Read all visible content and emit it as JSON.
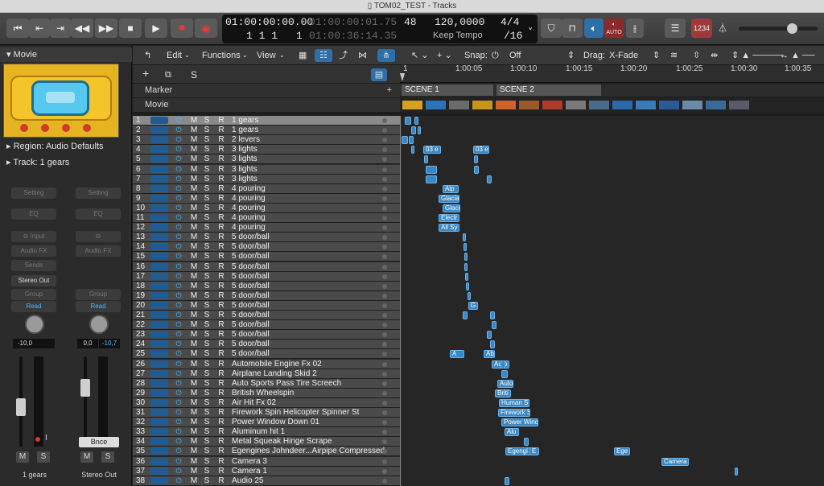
{
  "window": {
    "title": "TOM02_TEST - Tracks"
  },
  "control_bar": {
    "lcd": {
      "position_time": "01:00:00:00.00",
      "secondary_time": "01:00:00:01.75",
      "bar_position": "1  1  1",
      "beat_sub": "1",
      "time_right": "01:00:36:14.35",
      "tempo_label": "48",
      "tempo_value": "120,0000",
      "tempo_mode": "Keep Tempo",
      "signature": "4/4",
      "division": "/16"
    },
    "lcd_button": "1234",
    "auto_label": "AUTO"
  },
  "inspector": {
    "movie_label": "Movie",
    "region_label": "Region: Audio Defaults",
    "track_label": "Track:  1 gears",
    "strip_left": {
      "setting": "Setting",
      "eq": "EQ",
      "input": "Input",
      "audio_fx": "Audio FX",
      "sends": "Sends",
      "output": "Stereo Out",
      "group": "Group",
      "read": "Read",
      "vol_left": "-10,0",
      "vol_right": "",
      "mute": "M",
      "solo": "S",
      "name": "1 gears",
      "rec_i": "I"
    },
    "strip_right": {
      "setting": "Setting",
      "eq": "EQ",
      "audio_fx": "Audio FX",
      "group": "Group",
      "read": "Read",
      "vol_left": "0,0",
      "vol_right": "-10,7",
      "bounce": "Bnce",
      "mute": "M",
      "solo": "S",
      "name": "Stereo Out"
    }
  },
  "tracks_toolbar": {
    "edit": "Edit",
    "functions": "Functions",
    "view": "View",
    "snap_label": "Snap:",
    "snap_value": "Off",
    "drag_label": "Drag:",
    "drag_value": "X-Fade"
  },
  "global_tracks": {
    "marker": "Marker",
    "movie": "Movie",
    "scene1": "SCENE 1",
    "scene2": "SCENE 2"
  },
  "ruler": {
    "ticks": [
      "1",
      "1:00:05",
      "1:00:10",
      "1:00:15",
      "1:00:20",
      "1:00:25",
      "1:00:30",
      "1:00:35"
    ]
  },
  "track_buttons": {
    "mute": "M",
    "solo": "S",
    "record": "R"
  },
  "tracks": [
    {
      "num": "1",
      "name": "1 gears"
    },
    {
      "num": "2",
      "name": "1 gears"
    },
    {
      "num": "3",
      "name": "2 levers"
    },
    {
      "num": "4",
      "name": "3 lights"
    },
    {
      "num": "5",
      "name": "3 lights"
    },
    {
      "num": "6",
      "name": "3 lights"
    },
    {
      "num": "7",
      "name": "3 lights"
    },
    {
      "num": "8",
      "name": "4 pouring"
    },
    {
      "num": "9",
      "name": "4 pouring"
    },
    {
      "num": "10",
      "name": "4 pouring"
    },
    {
      "num": "11",
      "name": "4 pouring"
    },
    {
      "num": "12",
      "name": "4 pouring"
    },
    {
      "num": "13",
      "name": "5 door/ball"
    },
    {
      "num": "14",
      "name": "5 door/ball"
    },
    {
      "num": "15",
      "name": "5 door/ball"
    },
    {
      "num": "16",
      "name": "5 door/ball"
    },
    {
      "num": "17",
      "name": "5 door/ball"
    },
    {
      "num": "18",
      "name": "5 door/ball"
    },
    {
      "num": "19",
      "name": "5 door/ball"
    },
    {
      "num": "20",
      "name": "5 door/ball"
    },
    {
      "num": "21",
      "name": "5 door/ball"
    },
    {
      "num": "22",
      "name": "5 door/ball"
    },
    {
      "num": "23",
      "name": "5 door/ball"
    },
    {
      "num": "24",
      "name": "5 door/ball"
    },
    {
      "num": "25",
      "name": "5 door/ball"
    },
    {
      "num": "26",
      "name": "Automobile Engine Fx 02"
    },
    {
      "num": "27",
      "name": "Airplane Landing Skid 2"
    },
    {
      "num": "28",
      "name": "Auto Sports Pass Tire Screech"
    },
    {
      "num": "29",
      "name": "British Wheelspin"
    },
    {
      "num": "30",
      "name": "Air Hit Fx 02"
    },
    {
      "num": "31",
      "name": "Firework Spin Helicopter Spinner St"
    },
    {
      "num": "32",
      "name": "Power Window Down 01"
    },
    {
      "num": "33",
      "name": "Aluminum hit 1"
    },
    {
      "num": "34",
      "name": "Metal Squeak Hinge Scrape"
    },
    {
      "num": "35",
      "name": "Egengines Johndeer...Airpipe Compressed"
    },
    {
      "num": "36",
      "name": "Camera 3"
    },
    {
      "num": "37",
      "name": "Camera 1"
    },
    {
      "num": "38",
      "name": "Audio 25"
    }
  ],
  "regions": [
    {
      "row": 4,
      "text": "03 e"
    },
    {
      "row": 4,
      "text": "03 e"
    },
    {
      "row": 8,
      "text": "Alp"
    },
    {
      "row": 9,
      "text": "Glacia"
    },
    {
      "row": 10,
      "text": "Glaci"
    },
    {
      "row": 11,
      "text": "Electr"
    },
    {
      "row": 12,
      "text": "All Sy"
    },
    {
      "row": 20,
      "text": "G"
    },
    {
      "row": 25,
      "text": "Abr"
    },
    {
      "row": 25,
      "text": "A"
    },
    {
      "row": 26,
      "text": "Auto"
    },
    {
      "row": 28,
      "text": "Auto"
    },
    {
      "row": 29,
      "text": "Briti"
    },
    {
      "row": 30,
      "text": "Human S"
    },
    {
      "row": 31,
      "text": "Firework S"
    },
    {
      "row": 32,
      "text": "Power Wind"
    },
    {
      "row": 33,
      "text": "Alu"
    },
    {
      "row": 35,
      "text": "Egengi"
    },
    {
      "row": 35,
      "text": "E"
    },
    {
      "row": 35,
      "text": "Ege"
    },
    {
      "row": 36,
      "text": "Camera"
    }
  ]
}
